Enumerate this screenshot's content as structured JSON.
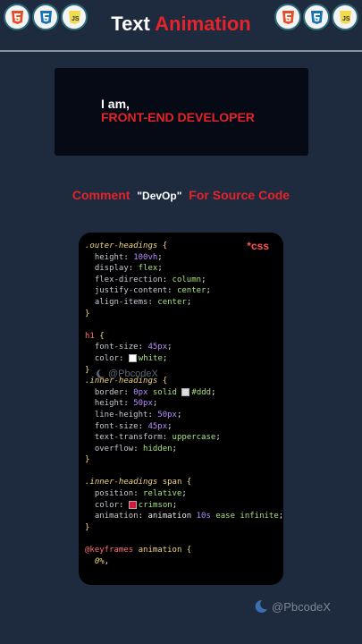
{
  "header": {
    "title_part1": "Text",
    "title_part2": "Animation",
    "badges_left": [
      "html5-icon",
      "css3-icon",
      "js-icon"
    ],
    "badges_right": [
      "html5-icon",
      "css3-icon",
      "js-icon"
    ]
  },
  "preview": {
    "line1": "I am,",
    "line2": "FRONT-END DEVELOPER"
  },
  "comment": {
    "prefix": "Comment",
    "keyword": "\"DevOp\"",
    "suffix": "For Source Code"
  },
  "code": {
    "badge": "*css",
    "lines": [
      [
        {
          "t": ".outer-headings",
          "c": "sel"
        },
        {
          "t": " {",
          "c": "brace"
        }
      ],
      [
        {
          "t": "  height",
          "c": "prop"
        },
        {
          "t": ": ",
          "c": "plain"
        },
        {
          "t": "100vh",
          "c": "num"
        },
        {
          "t": ";",
          "c": "plain"
        }
      ],
      [
        {
          "t": "  display",
          "c": "prop"
        },
        {
          "t": ": ",
          "c": "plain"
        },
        {
          "t": "flex",
          "c": "val"
        },
        {
          "t": ";",
          "c": "plain"
        }
      ],
      [
        {
          "t": "  flex-direction",
          "c": "prop"
        },
        {
          "t": ": ",
          "c": "plain"
        },
        {
          "t": "column",
          "c": "val"
        },
        {
          "t": ";",
          "c": "plain"
        }
      ],
      [
        {
          "t": "  justify-content",
          "c": "prop"
        },
        {
          "t": ": ",
          "c": "plain"
        },
        {
          "t": "center",
          "c": "val"
        },
        {
          "t": ";",
          "c": "plain"
        }
      ],
      [
        {
          "t": "  align-items",
          "c": "prop"
        },
        {
          "t": ": ",
          "c": "plain"
        },
        {
          "t": "center",
          "c": "val"
        },
        {
          "t": ";",
          "c": "plain"
        }
      ],
      [
        {
          "t": "}",
          "c": "brace"
        }
      ],
      [],
      [
        {
          "t": "h1",
          "c": "kw"
        },
        {
          "t": " {",
          "c": "brace"
        }
      ],
      [
        {
          "t": "  font-size",
          "c": "prop"
        },
        {
          "t": ": ",
          "c": "plain"
        },
        {
          "t": "45px",
          "c": "num"
        },
        {
          "t": ";",
          "c": "plain"
        }
      ],
      [
        {
          "t": "  color",
          "c": "prop"
        },
        {
          "t": ": ",
          "c": "plain"
        },
        {
          "sw": "#ffffff"
        },
        {
          "t": "white",
          "c": "val"
        },
        {
          "t": ";",
          "c": "plain"
        }
      ],
      [
        {
          "t": "}",
          "c": "brace"
        }
      ],
      [
        {
          "t": ".inner-headings",
          "c": "sel"
        },
        {
          "t": " {",
          "c": "brace"
        }
      ],
      [
        {
          "t": "  border",
          "c": "prop"
        },
        {
          "t": ": ",
          "c": "plain"
        },
        {
          "t": "0px",
          "c": "num"
        },
        {
          "t": " solid ",
          "c": "val"
        },
        {
          "sw": "#dddddd"
        },
        {
          "t": "#ddd",
          "c": "val"
        },
        {
          "t": ";",
          "c": "plain"
        }
      ],
      [
        {
          "t": "  height",
          "c": "prop"
        },
        {
          "t": ": ",
          "c": "plain"
        },
        {
          "t": "50px",
          "c": "num"
        },
        {
          "t": ";",
          "c": "plain"
        }
      ],
      [
        {
          "t": "  line-height",
          "c": "prop"
        },
        {
          "t": ": ",
          "c": "plain"
        },
        {
          "t": "50px",
          "c": "num"
        },
        {
          "t": ";",
          "c": "plain"
        }
      ],
      [
        {
          "t": "  font-size",
          "c": "prop"
        },
        {
          "t": ": ",
          "c": "plain"
        },
        {
          "t": "45px",
          "c": "num"
        },
        {
          "t": ";",
          "c": "plain"
        }
      ],
      [
        {
          "t": "  text-transform",
          "c": "prop"
        },
        {
          "t": ": ",
          "c": "plain"
        },
        {
          "t": "uppercase",
          "c": "val"
        },
        {
          "t": ";",
          "c": "plain"
        }
      ],
      [
        {
          "t": "  overflow",
          "c": "prop"
        },
        {
          "t": ": ",
          "c": "plain"
        },
        {
          "t": "hidden",
          "c": "val"
        },
        {
          "t": ";",
          "c": "plain"
        }
      ],
      [
        {
          "t": "}",
          "c": "brace"
        }
      ],
      [],
      [
        {
          "t": ".inner-headings",
          "c": "sel"
        },
        {
          "t": " span",
          "c": "selp"
        },
        {
          "t": " {",
          "c": "brace"
        }
      ],
      [
        {
          "t": "  position",
          "c": "prop"
        },
        {
          "t": ": ",
          "c": "plain"
        },
        {
          "t": "relative",
          "c": "val"
        },
        {
          "t": ";",
          "c": "plain"
        }
      ],
      [
        {
          "t": "  color",
          "c": "prop"
        },
        {
          "t": ": ",
          "c": "plain"
        },
        {
          "sw": "#dc143c"
        },
        {
          "t": "crimson",
          "c": "val"
        },
        {
          "t": ";",
          "c": "plain"
        }
      ],
      [
        {
          "t": "  animation",
          "c": "prop"
        },
        {
          "t": ": ",
          "c": "plain"
        },
        {
          "t": "animation ",
          "c": "plain"
        },
        {
          "t": "10s",
          "c": "num"
        },
        {
          "t": " ease infinite",
          "c": "val"
        },
        {
          "t": ";",
          "c": "plain"
        }
      ],
      [
        {
          "t": "}",
          "c": "brace"
        }
      ],
      [],
      [
        {
          "t": "@keyframes",
          "c": "kw"
        },
        {
          "t": " animation {",
          "c": "selp"
        }
      ],
      [
        {
          "t": "  0%",
          "c": "sel"
        },
        {
          "t": ",",
          "c": "plain"
        }
      ]
    ]
  },
  "watermark_code": "@PbcodeX",
  "watermark": "@PbcodeX",
  "colors": {
    "background": "#1e2a3d",
    "accent": "#e3242b",
    "code_bg": "#000000"
  }
}
